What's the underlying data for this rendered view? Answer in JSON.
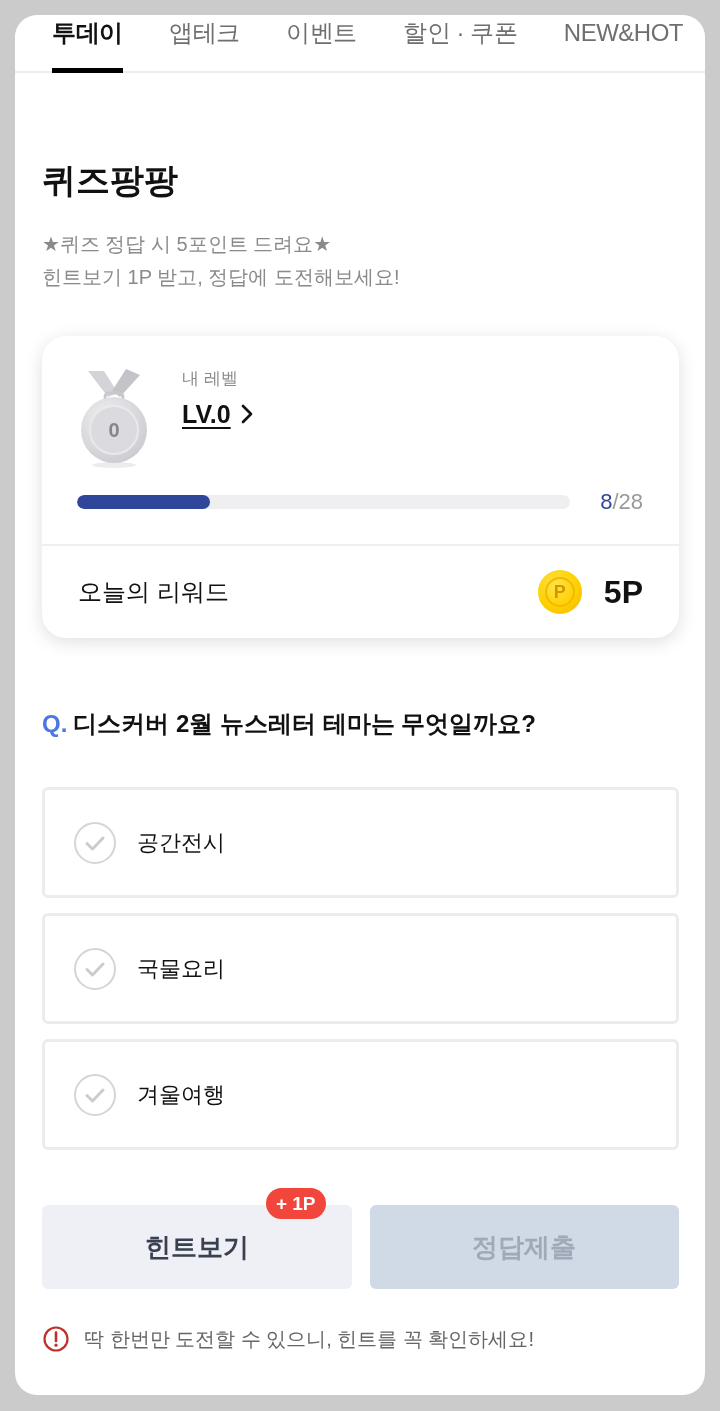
{
  "tabs": [
    {
      "label": "투데이",
      "selected": true
    },
    {
      "label": "앱테크",
      "selected": false
    },
    {
      "label": "이벤트",
      "selected": false
    },
    {
      "label": "할인 · 쿠폰",
      "selected": false
    },
    {
      "label": "NEW&HOT",
      "selected": false
    }
  ],
  "quiz": {
    "title": "퀴즈팡팡",
    "subtitle_lines": [
      "★퀴즈 정답 시 5포인트 드려요★",
      "힌트보기 1P 받고, 정답에 도전해보세요!"
    ]
  },
  "level_card": {
    "medal_number": "0",
    "label": "내 레벨",
    "level_name": "LV.0",
    "progress": {
      "level": 0.27,
      "current": "8",
      "rest": "/28"
    },
    "reward_label": "오늘의 리워드",
    "coin_symbol": "P",
    "reward": "5P"
  },
  "question": {
    "prefix": "Q.",
    "text": "디스커버 2월 뉴스레터 테마는 무엇일까요?"
  },
  "options": [
    {
      "label": "공간전시",
      "selected": false
    },
    {
      "label": "국물요리",
      "selected": false
    },
    {
      "label": "겨울여행",
      "selected": false
    }
  ],
  "buttons": [
    {
      "label": "힌트보기",
      "disabled": false,
      "badge": "+ 1P"
    },
    {
      "label": "정답제출",
      "disabled": true
    }
  ],
  "notice": "딱 한번만 도전할 수 있으니, 힌트를 꼭 확인하세요!"
}
